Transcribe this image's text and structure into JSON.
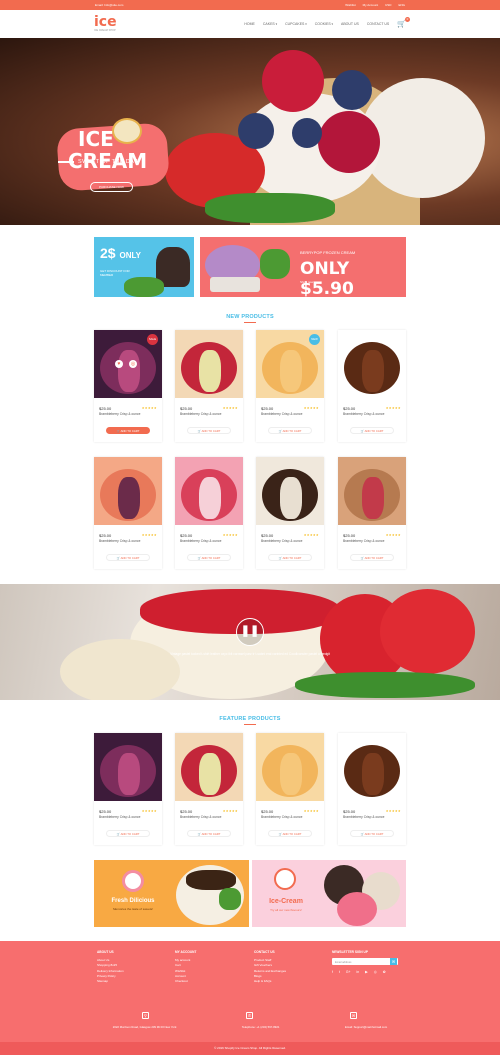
{
  "topbar": {
    "email": "Email: Info@site.com",
    "links": [
      "Wishlist",
      "My Account",
      "USD",
      "ENG"
    ]
  },
  "header": {
    "logo_text": "ice",
    "logo_sub": "ICE CREAM SHOP",
    "nav": [
      {
        "label": "HOME",
        "dropdown": false
      },
      {
        "label": "CAKES",
        "dropdown": true
      },
      {
        "label": "CUPCAKES",
        "dropdown": true
      },
      {
        "label": "COOKIES",
        "dropdown": true
      },
      {
        "label": "ABOUT US",
        "dropdown": false
      },
      {
        "label": "CONTACT US",
        "dropdown": false
      }
    ],
    "cart_count": "0"
  },
  "hero": {
    "title_line1": "ICE",
    "title_line2": "CREAM",
    "subtitle": "SWEET OF THE DAY",
    "button": "PURCHASE NOW"
  },
  "promo1": {
    "price": "2$",
    "only": "ONLY",
    "text": "GET DISCOUNT FOR MEMBER"
  },
  "promo2": {
    "line1": "BERRYPOP FROZEN CREAM",
    "line2": "ONLY $5.90",
    "line3": "Shop now »"
  },
  "new_products_title": "NEW PRODUCTS",
  "feature_products_title": "FEATURE PRODUCTS",
  "product_defaults": {
    "price": "$25.00",
    "stars": "★★★★★",
    "name": "Brambleberry Crisp & ounce",
    "cart": "ADD TO CART"
  },
  "badges": {
    "sale": "SALE",
    "new": "NEW"
  },
  "video_text": "Vintage pastel tucked t-shirt leather oxyc ibit carrasel pasr tr t-sabnt eral carinted ed Coodlconster pastel a wedgit",
  "banner_left": {
    "title": "Fresh Dilicious",
    "text": "Memories the taste of sweets!"
  },
  "banner_right": {
    "title": "Ice-Cream",
    "text": "Try all our new flavours!"
  },
  "footer": {
    "about": {
      "title": "ABOUT US",
      "items": [
        "About Us",
        "Shopping 8x25",
        "Delivery Information",
        "Privacy Policy",
        "Sitemap"
      ]
    },
    "account": {
      "title": "MY ACCOUNT",
      "items": [
        "My account",
        "Cart",
        "Wishlist",
        "Account",
        "Checkout"
      ]
    },
    "contact": {
      "title": "CONTACT US",
      "items": [
        "Product Staff",
        "Gift Vouchers",
        "Returns and Exchanges",
        "Blogs",
        "Help & FAQs"
      ]
    },
    "newsletter": {
      "title": "NEWSLETTER SIGN UP",
      "placeholder": "Email address"
    },
    "social": [
      "f",
      "t",
      "G+",
      "in",
      "▶",
      "◎",
      "✿"
    ],
    "address": "2022 Morrison Road, Glasgow 239 Mt 00 New York",
    "phone": "Telephone: +1 (234) 567-8921",
    "email": "Email: Support@mail.hotmail.com",
    "copyright": "© 2016 Shopify Ice Cream Shop. All Rights Reserved."
  },
  "colors": {
    "primary": "#f26b4f",
    "accent": "#49bde6",
    "footer": "#f76e6e"
  }
}
